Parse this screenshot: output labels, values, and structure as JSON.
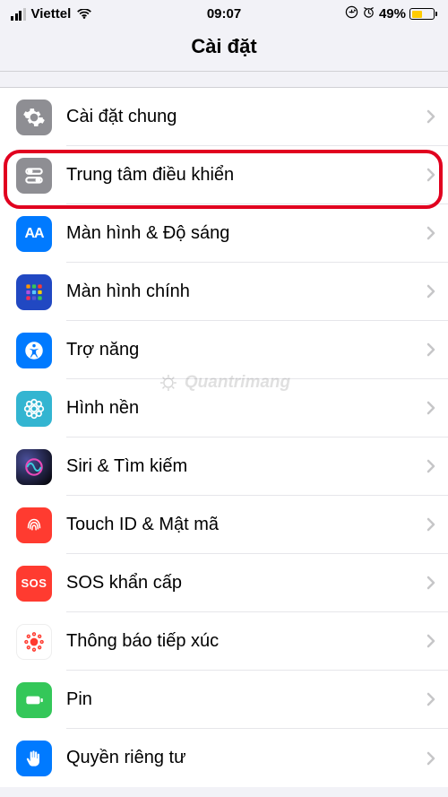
{
  "statusbar": {
    "carrier": "Viettel",
    "time": "09:07",
    "battery_percent": "49%"
  },
  "header": {
    "title": "Cài đặt"
  },
  "items": {
    "general": {
      "label": "Cài đặt chung"
    },
    "control_center": {
      "label": "Trung tâm điều khiển"
    },
    "display": {
      "label": "Màn hình & Độ sáng"
    },
    "home_screen": {
      "label": "Màn hình chính"
    },
    "accessibility": {
      "label": "Trợ năng"
    },
    "wallpaper": {
      "label": "Hình nền"
    },
    "siri": {
      "label": "Siri & Tìm kiếm"
    },
    "touch_id": {
      "label": "Touch ID & Mật mã"
    },
    "sos": {
      "label": "SOS khẩn cấp"
    },
    "exposure": {
      "label": "Thông báo tiếp xúc"
    },
    "battery": {
      "label": "Pin"
    },
    "privacy": {
      "label": "Quyền riêng tư"
    }
  },
  "watermark": {
    "text": "Quantrimang"
  }
}
